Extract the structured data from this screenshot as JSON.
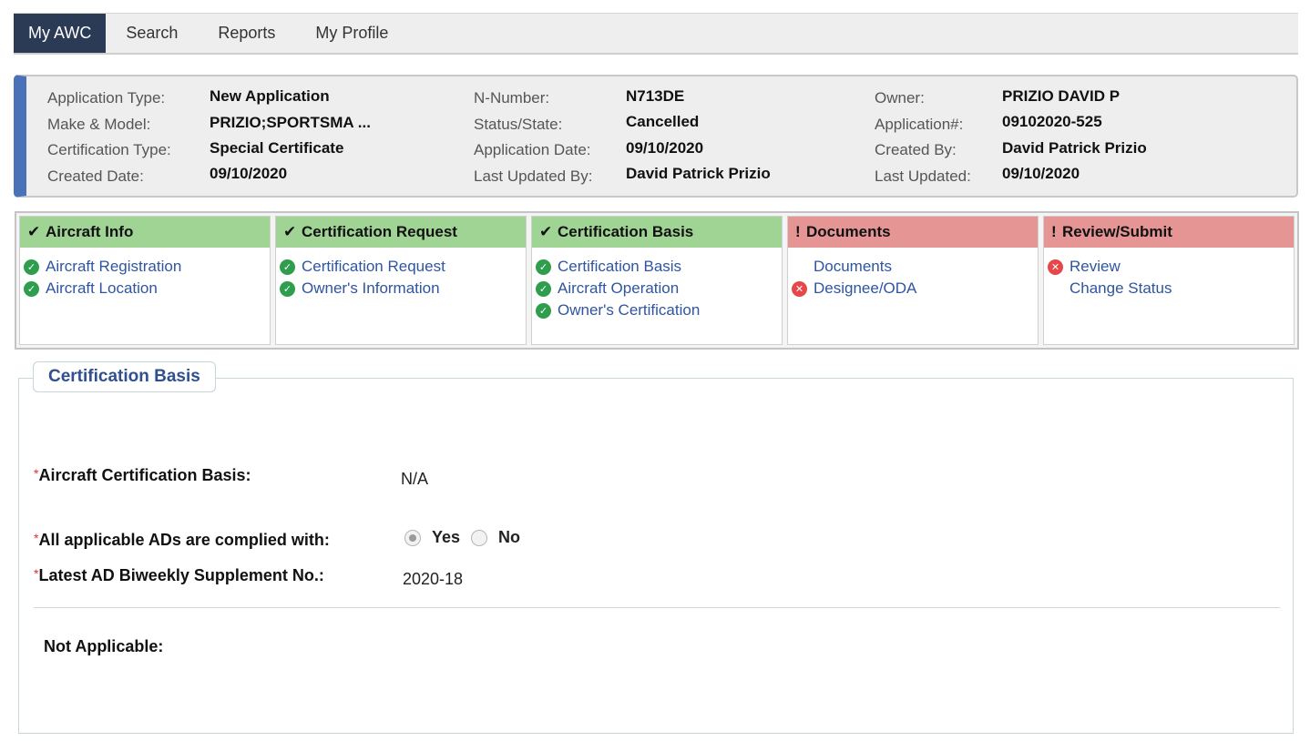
{
  "nav": {
    "items": [
      {
        "label": "My AWC",
        "active": true
      },
      {
        "label": "Search"
      },
      {
        "label": "Reports"
      },
      {
        "label": "My Profile"
      }
    ]
  },
  "summary": {
    "application_type": {
      "label": "Application Type:",
      "value": "New Application"
    },
    "make_model": {
      "label": "Make & Model:",
      "value": "PRIZIO;SPORTSMA ..."
    },
    "certification_type": {
      "label": "Certification Type:",
      "value": "Special Certificate"
    },
    "created_date": {
      "label": "Created Date:",
      "value": "09/10/2020"
    },
    "n_number": {
      "label": "N-Number:",
      "value": "N713DE"
    },
    "status_state": {
      "label": "Status/State:",
      "value": "Cancelled"
    },
    "application_date": {
      "label": "Application Date:",
      "value": "09/10/2020"
    },
    "last_updated_by": {
      "label": "Last Updated By:",
      "value": "David Patrick Prizio"
    },
    "owner": {
      "label": "Owner:",
      "value": "PRIZIO DAVID P"
    },
    "application_no": {
      "label": "Application#:",
      "value": "09102020-525"
    },
    "created_by": {
      "label": "Created By:",
      "value": "David Patrick Prizio"
    },
    "last_updated": {
      "label": "Last Updated:",
      "value": "09/10/2020"
    }
  },
  "steps": [
    {
      "title": "Aircraft Info",
      "status": "complete",
      "links": [
        {
          "label": "Aircraft Registration",
          "status": "ok"
        },
        {
          "label": "Aircraft Location",
          "status": "ok"
        }
      ]
    },
    {
      "title": "Certification Request",
      "status": "complete",
      "links": [
        {
          "label": "Certification Request",
          "status": "ok"
        },
        {
          "label": "Owner's Information",
          "status": "ok"
        }
      ]
    },
    {
      "title": "Certification Basis",
      "status": "complete",
      "links": [
        {
          "label": "Certification Basis",
          "status": "ok"
        },
        {
          "label": "Aircraft Operation",
          "status": "ok"
        },
        {
          "label": "Owner's Certification",
          "status": "ok"
        }
      ]
    },
    {
      "title": "Documents",
      "status": "incomplete",
      "links": [
        {
          "label": "Documents",
          "status": "none"
        },
        {
          "label": "Designee/ODA",
          "status": "error"
        }
      ]
    },
    {
      "title": "Review/Submit",
      "status": "incomplete",
      "links": [
        {
          "label": "Review",
          "status": "error"
        },
        {
          "label": "Change Status",
          "status": "none"
        }
      ]
    }
  ],
  "section": {
    "legend": "Certification Basis",
    "required_mark": "*",
    "basis_label": "Aircraft Certification Basis:",
    "basis_value": "N/A",
    "ads_label": "All applicable ADs are complied with:",
    "ads_yes": "Yes",
    "ads_no": "No",
    "ads_selected": "Yes",
    "supplement_label": "Latest AD Biweekly Supplement No.:",
    "supplement_value": "2020-18",
    "not_applicable_label": "Not Applicable:"
  },
  "colors": {
    "nav_active": "#2b3a55",
    "accent_bar": "#4a72b8",
    "step_complete": "#a0d495",
    "step_incomplete": "#e49594",
    "link": "#2f55a0",
    "ok_icon": "#2e9e4c",
    "error_icon": "#e5474a"
  }
}
